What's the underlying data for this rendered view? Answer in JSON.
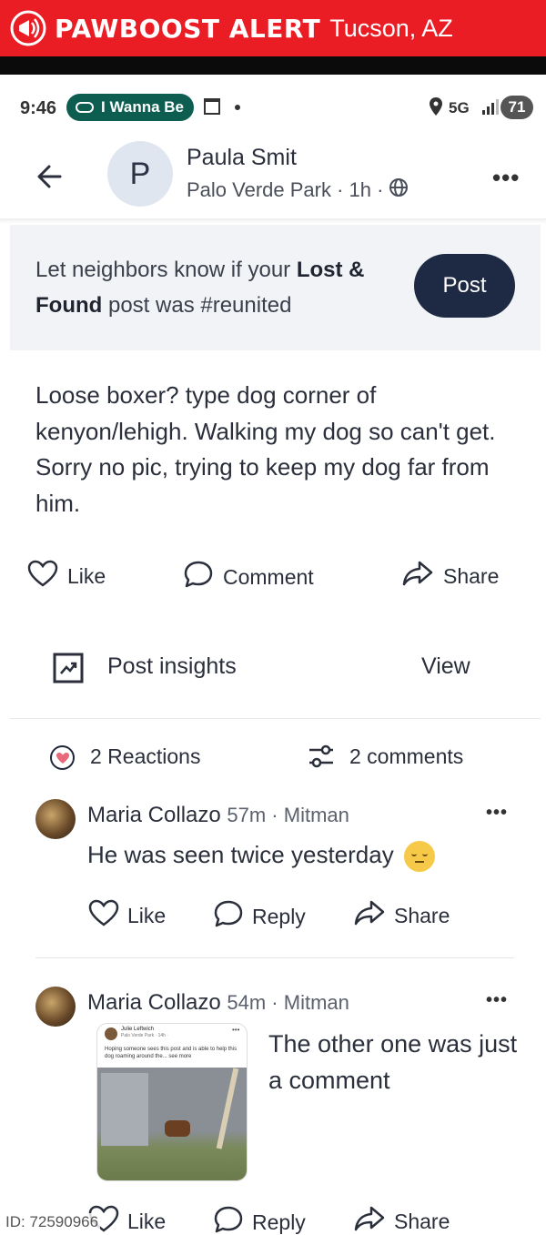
{
  "banner": {
    "brand": "PAWBOOST ALERT",
    "location": "Tucson, AZ",
    "color": "#ea1c24"
  },
  "status_bar": {
    "time": "9:46",
    "media_pill": "I Wanna Be",
    "network": "5G",
    "battery": "71"
  },
  "post": {
    "author": "Paula Smit",
    "meta": "Palo Verde Park · 1h ·",
    "avatar_initial": "P",
    "reunited_card": {
      "text_before": "Let neighbors know if your ",
      "text_bold": "Lost & Found",
      "text_after": " post was #reunited",
      "button": "Post"
    },
    "body": "Loose  boxer? type dog corner of kenyon/lehigh. Walking my dog so can't get. Sorry no pic, trying to keep my dog far from him.",
    "actions": {
      "like": "Like",
      "comment": "Comment",
      "share": "Share"
    },
    "insights": {
      "label": "Post insights",
      "view": "View"
    },
    "reactions": "2 Reactions",
    "comments_count": "2 comments"
  },
  "comments": [
    {
      "author": "Maria Collazo",
      "meta": "57m · Mitman",
      "text": "He was seen twice yesterday",
      "emoji": "pensive-face-emoji",
      "actions": {
        "like": "Like",
        "reply": "Reply",
        "share": "Share"
      }
    },
    {
      "author": "Maria Collazo",
      "meta": "54m · Mitman",
      "text": "The other one was just a comment",
      "thumbnail": {
        "author": "Julie Leftwich",
        "meta": "Palo Verde Park · 14h ·",
        "caption": "Hoping someone sees this post and is able to help this dog roaming around the... see more"
      },
      "actions": {
        "like": "Like",
        "reply": "Reply",
        "share": "Share"
      }
    }
  ],
  "footer_id": "ID: 72590966"
}
